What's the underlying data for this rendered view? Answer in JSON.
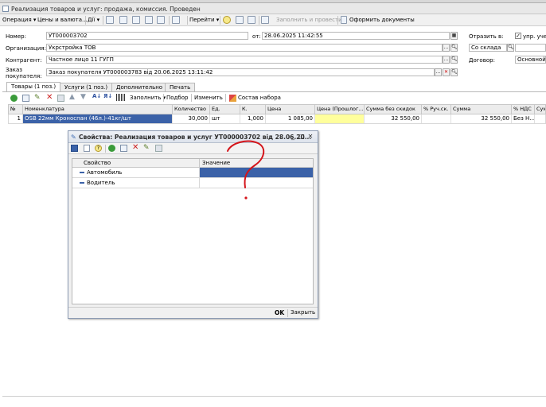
{
  "window": {
    "title": "Реализация товаров и услуг: продажа, комиссия. Проведен"
  },
  "toolbar": {
    "operation": "Операция ▾",
    "prices": "Цены и валюта...",
    "actions": "Дії ▾",
    "goto": "Перейти ▾",
    "fill_post": "Заполнить и провести",
    "docs": "Оформить документы"
  },
  "header": {
    "number_label": "Номер:",
    "number_value": "УТ000003702",
    "date_label": "от:",
    "date_value": "28.06.2025 11:42:55",
    "reflect_label": "Отразить в:",
    "upr_label": "упр. учете",
    "org_label": "Организация:",
    "org_value": "Укрстройка ТОВ",
    "warehouse_value": "Со склада",
    "counterparty_label": "Контрагент:",
    "counterparty_value": "Частное лицо 11 ГУГП",
    "contract_label": "Договор:",
    "contract_value": "Основной до",
    "order_label": "Заказ покупателя:",
    "order_value": "Заказ покупателя УТ000003783 від 20.06.2025 13:11:42"
  },
  "tabs": [
    {
      "label": "Товары (1 поз.)"
    },
    {
      "label": "Услуги (1 поз.)"
    },
    {
      "label": "Дополнительно"
    },
    {
      "label": "Печать"
    }
  ],
  "grid_toolbar": {
    "fill": "Заполнить ▾",
    "pick": "Подбор",
    "change": "Изменить",
    "kit": "Состав набора"
  },
  "grid": {
    "columns": [
      "№",
      "Номенклатура",
      "Количество",
      "Ед.",
      "К.",
      "Цена",
      "Цена (Прошлог...",
      "Сумма без скидок",
      "% Руч.ск.",
      "Сумма",
      "% НДС",
      "Сум"
    ],
    "rows": [
      {
        "n": "1",
        "item": "OSB 22мм Кроноспан (46л.)-41кг/шт",
        "qty": "30,000",
        "unit": "шт",
        "k": "1,000",
        "price": "1 085,00",
        "prev_price": "",
        "sum_nodisc": "32 550,00",
        "manual": "",
        "sum": "32 550,00",
        "vat": "Без Н..."
      }
    ]
  },
  "dialog": {
    "title": "Свойства: Реализация товаров и услуг УТ000003702 від 28.06.20...",
    "col_property": "Свойство",
    "col_value": "Значение",
    "rows": [
      {
        "name": "Автомобиль",
        "value": ""
      },
      {
        "name": "Водитель",
        "value": ""
      }
    ],
    "ok": "OK",
    "close": "Закрыть"
  },
  "colors": {
    "selection": "#3b62a8",
    "highlight_yellow": "#ffff9c",
    "annotation": "#d4141a"
  }
}
